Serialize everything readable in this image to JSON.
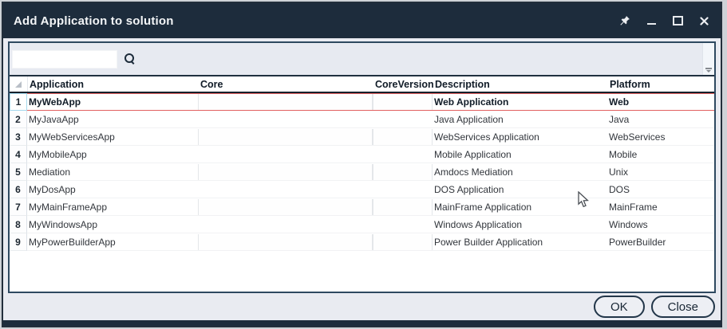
{
  "window": {
    "title": "Add Application to solution",
    "controls": {
      "pin_icon": "pin",
      "minimize_icon": "minimize",
      "maximize_icon": "maximize",
      "close_icon": "close"
    }
  },
  "search": {
    "value": "",
    "icon": "magnifier"
  },
  "table": {
    "columns": [
      "Application",
      "Core",
      "CoreVersion",
      "Description",
      "Platform"
    ],
    "rows": [
      {
        "num": "1",
        "application": "MyWebApp",
        "core": "",
        "core_version": "",
        "description": "Web Application",
        "platform": "Web",
        "selected": true
      },
      {
        "num": "2",
        "application": "MyJavaApp",
        "core": "",
        "core_version": "",
        "description": "Java Application",
        "platform": "Java",
        "selected": false
      },
      {
        "num": "3",
        "application": "MyWebServicesApp",
        "core": "",
        "core_version": "",
        "description": "WebServices Application",
        "platform": "WebServices",
        "selected": false
      },
      {
        "num": "4",
        "application": "MyMobileApp",
        "core": "",
        "core_version": "",
        "description": "Mobile Application",
        "platform": "Mobile",
        "selected": false
      },
      {
        "num": "5",
        "application": "Mediation",
        "core": "",
        "core_version": "",
        "description": "Amdocs Mediation",
        "platform": "Unix",
        "selected": false
      },
      {
        "num": "6",
        "application": "MyDosApp",
        "core": "",
        "core_version": "",
        "description": "DOS Application",
        "platform": "DOS",
        "selected": false
      },
      {
        "num": "7",
        "application": "MyMainFrameApp",
        "core": "",
        "core_version": "",
        "description": "MainFrame Application",
        "platform": "MainFrame",
        "selected": false
      },
      {
        "num": "8",
        "application": "MyWindowsApp",
        "core": "",
        "core_version": "",
        "description": "Windows Application",
        "platform": "Windows",
        "selected": false
      },
      {
        "num": "9",
        "application": "MyPowerBuilderApp",
        "core": "",
        "core_version": "",
        "description": "Power Builder Application",
        "platform": "PowerBuilder",
        "selected": false
      }
    ]
  },
  "footer": {
    "ok_label": "OK",
    "close_label": "Close"
  },
  "colors": {
    "titlebar": "#1d2c3c",
    "selection_border": "#e16060",
    "frame_border": "#2e4960",
    "panel_bg": "#e9ebf1"
  }
}
